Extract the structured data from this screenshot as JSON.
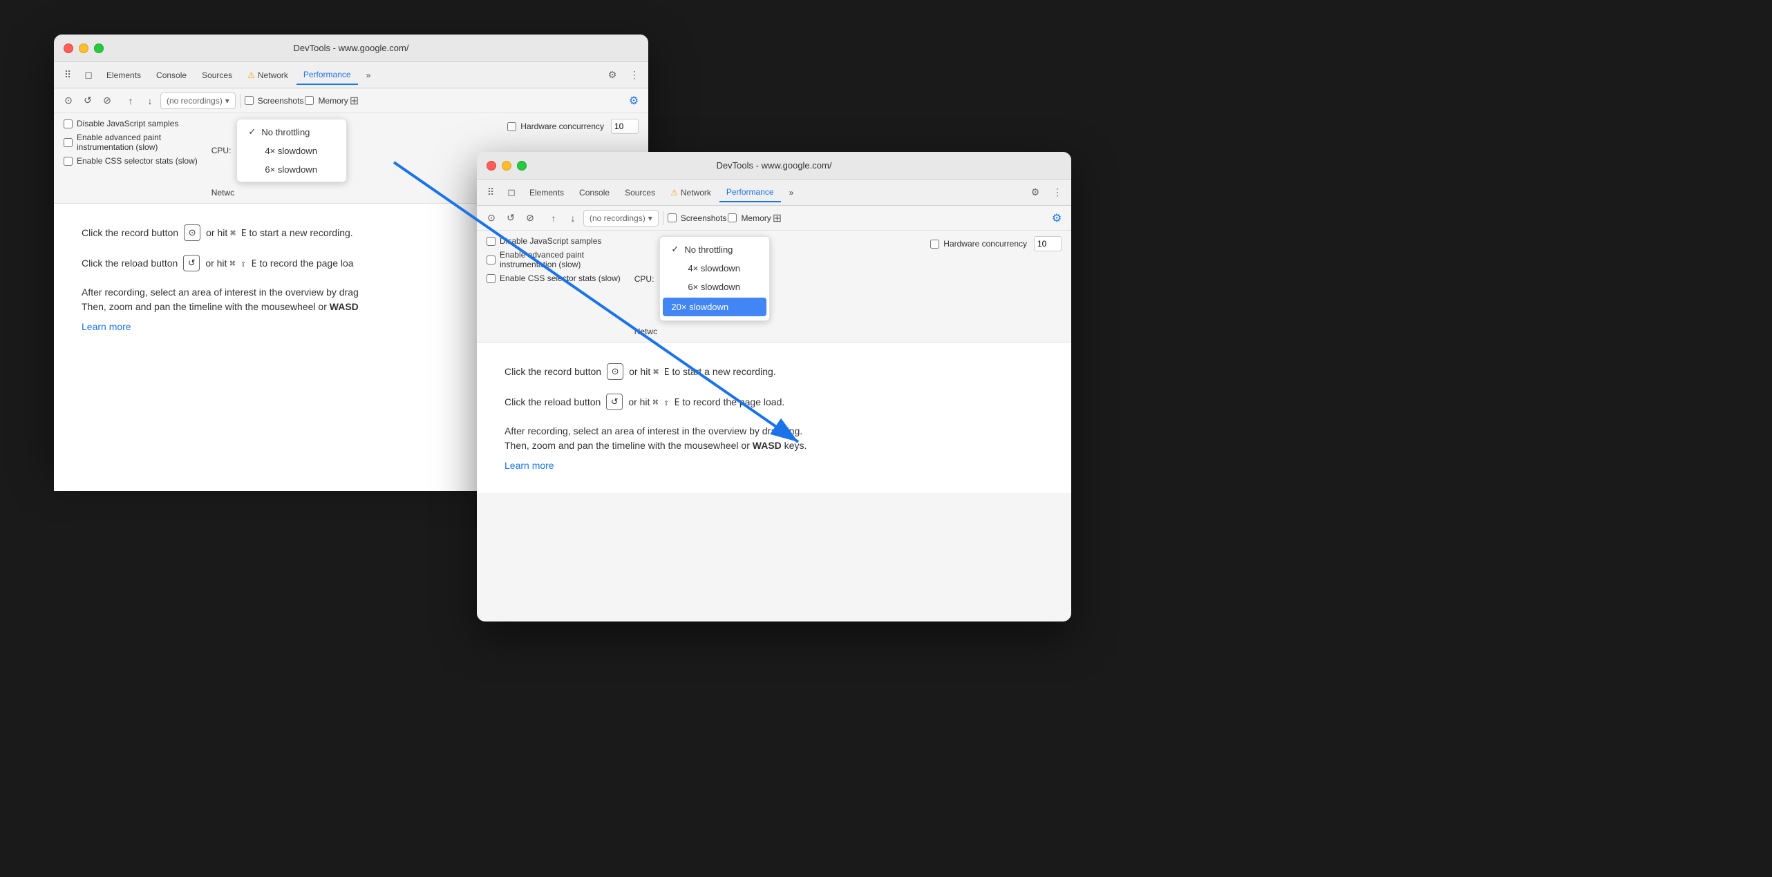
{
  "window": {
    "title": "DevTools - www.google.com/"
  },
  "tabs": {
    "icons": [
      "⠿",
      "□"
    ],
    "items": [
      {
        "label": "Elements",
        "active": false
      },
      {
        "label": "Console",
        "active": false
      },
      {
        "label": "Sources",
        "active": false
      },
      {
        "label": "Network",
        "active": false,
        "warning": true
      },
      {
        "label": "Performance",
        "active": true
      },
      {
        "label": "»",
        "active": false
      }
    ],
    "right": [
      "⚙",
      "⋮"
    ]
  },
  "toolbar": {
    "recordings_placeholder": "(no recordings)",
    "screenshots_label": "Screenshots",
    "memory_label": "Memory"
  },
  "settings": {
    "disable_js_label": "Disable JavaScript samples",
    "advanced_paint_label": "Enable advanced paint",
    "advanced_paint_sub": "instrumentation (slow)",
    "css_selector_label": "Enable CSS selector stats (slow)",
    "cpu_label": "CPU:",
    "network_label": "Netwc",
    "hardware_concurrency_label": "Hardware concurrency",
    "hardware_concurrency_value": "10"
  },
  "cpu_dropdown_back": {
    "items": [
      {
        "label": "No throttling",
        "checked": true
      },
      {
        "label": "4× slowdown",
        "checked": false
      },
      {
        "label": "6× slowdown",
        "checked": false
      }
    ]
  },
  "cpu_dropdown_front": {
    "items": [
      {
        "label": "No throttling",
        "checked": true
      },
      {
        "label": "4× slowdown",
        "checked": false
      },
      {
        "label": "6× slowdown",
        "checked": false
      },
      {
        "label": "20× slowdown",
        "checked": false,
        "highlighted": true
      }
    ]
  },
  "instructions": {
    "record_text1": "Click the record button",
    "record_text2": "or hit",
    "record_shortcut": "⌘ E",
    "record_text3": "to start a new recording.",
    "reload_text1": "Click the reload button",
    "reload_text2": "or hit",
    "reload_shortcut": "⌘ ⇧ E",
    "reload_text3": "to record the page load.",
    "description_line1": "After recording, select an area of interest in the overview by dragging.",
    "description_line2": "Then, zoom and pan the timeline with the mousewheel or",
    "description_wasd": "WASD",
    "description_line3": "keys.",
    "learn_more": "Learn more"
  }
}
